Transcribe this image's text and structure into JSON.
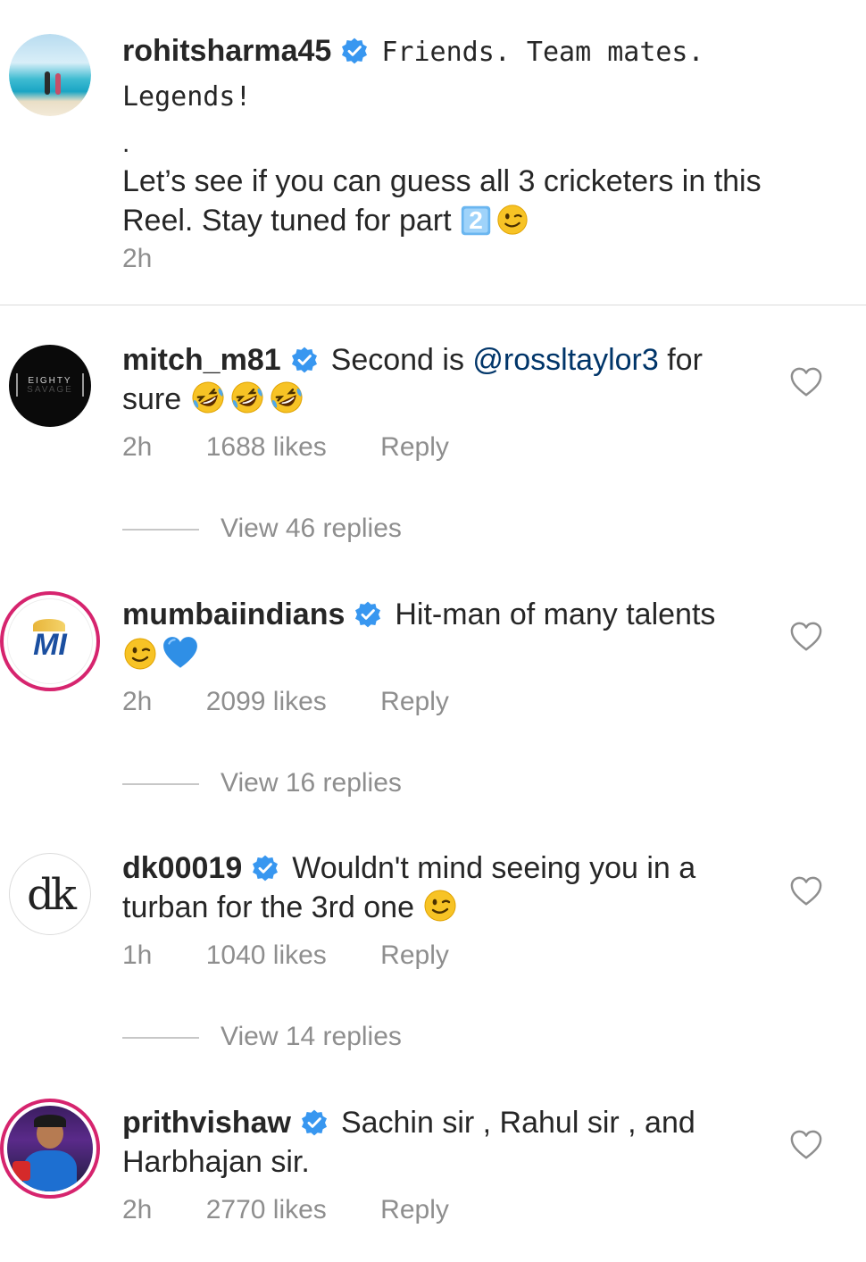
{
  "caption": {
    "username": "rohitsharma45",
    "text_line1": "Friends. Team mates.",
    "text_line2": "Legends!",
    "dot": ".",
    "body": "Let’s see if you can guess all 3 cricketers in this Reel. Stay tuned for part",
    "keycap": "2",
    "time": "2h"
  },
  "comments": [
    {
      "username": "mitch_m81",
      "text_before": "Second is",
      "mention": "@rossltaylor3",
      "text_after": "for sure",
      "time": "2h",
      "likes": "1688 likes",
      "reply": "Reply",
      "view_replies": "View 46 replies",
      "avatar_text_1": "EIGHTY",
      "avatar_text_2": "SAVAGE"
    },
    {
      "username": "mumbaiindians",
      "text": "Hit-man of many talents",
      "time": "2h",
      "likes": "2099 likes",
      "reply": "Reply",
      "view_replies": "View 16 replies",
      "avatar_text": "MI"
    },
    {
      "username": "dk00019",
      "text": "Wouldn't mind seeing you in a turban for the 3rd one",
      "time": "1h",
      "likes": "1040 likes",
      "reply": "Reply",
      "view_replies": "View 14 replies",
      "avatar_text": "dk"
    },
    {
      "username": "prithvishaw",
      "text": "Sachin sir , Rahul sir , and Harbhajan sir.",
      "time": "2h",
      "likes": "2770 likes",
      "reply": "Reply"
    }
  ],
  "colors": {
    "verified": "#3897f0",
    "meta": "#8e8e8e",
    "mention": "#003569",
    "story_ring": "#d6246e"
  },
  "icons": [
    "verified-icon",
    "heart-icon",
    "laughing-emoji",
    "wink-emoji",
    "blue-heart-emoji",
    "keycap-2-emoji"
  ]
}
